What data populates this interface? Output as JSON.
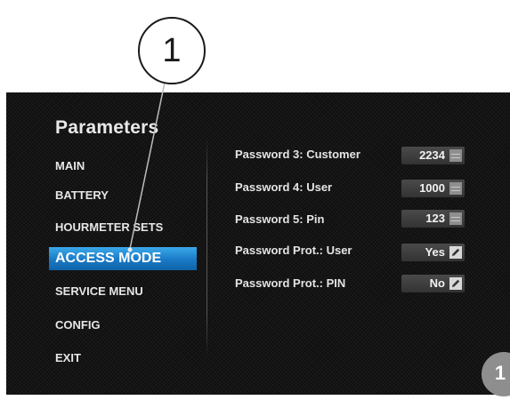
{
  "panel": {
    "title": "Parameters"
  },
  "menu": {
    "items": [
      {
        "label": "MAIN"
      },
      {
        "label": "BATTERY"
      },
      {
        "label": "HOURMETER SETS"
      },
      {
        "label": "ACCESS MODE"
      },
      {
        "label": "SERVICE MENU"
      },
      {
        "label": "CONFIG"
      },
      {
        "label": "EXIT"
      }
    ],
    "selected": "ACCESS MODE"
  },
  "params": [
    {
      "label": "Password 3: Customer",
      "value": "2234",
      "icon": "list-icon"
    },
    {
      "label": "Password 4: User",
      "value": "1000",
      "icon": "list-icon"
    },
    {
      "label": "Password 5: Pin",
      "value": "123",
      "icon": "list-icon"
    },
    {
      "label": "Password Prot.: User",
      "value": "Yes",
      "icon": "edit-icon"
    },
    {
      "label": "Password Prot.: PIN",
      "value": "No",
      "icon": "edit-icon"
    }
  ],
  "callout": {
    "number": "1"
  },
  "badge": {
    "number": "1"
  },
  "colors": {
    "accent": "#1a79c6",
    "screen_bg": "#0f0f0f",
    "badge": "#8e8e8e"
  }
}
